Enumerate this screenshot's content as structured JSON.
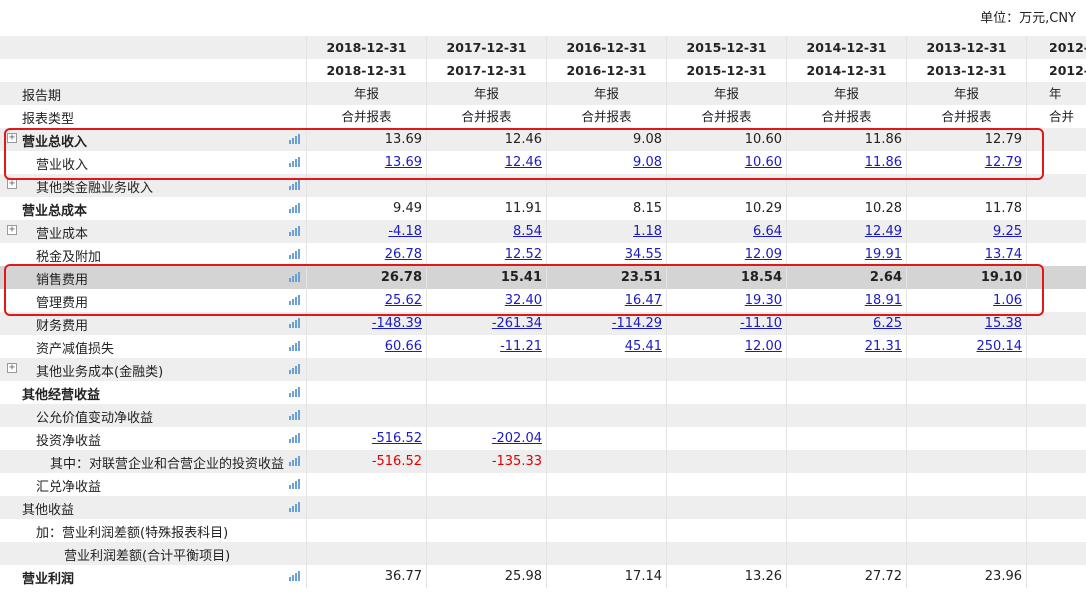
{
  "unit_label": "单位：万元,CNY",
  "header": {
    "dates_top": [
      "2018-12-31",
      "2017-12-31",
      "2016-12-31",
      "2015-12-31",
      "2014-12-31",
      "2013-12-31",
      "2012-"
    ],
    "dates_bottom": [
      "2018-12-31",
      "2017-12-31",
      "2016-12-31",
      "2015-12-31",
      "2014-12-31",
      "2013-12-31",
      "2012-"
    ],
    "period_label": "报告期",
    "periods": [
      "年报",
      "年报",
      "年报",
      "年报",
      "年报",
      "年报",
      "年"
    ],
    "type_label": "报表类型",
    "types": [
      "合并报表",
      "合并报表",
      "合并报表",
      "合并报表",
      "合并报表",
      "合并报表",
      "合并"
    ]
  },
  "rows": [
    {
      "label": "营业总收入",
      "bold": true,
      "expand": true,
      "chart": true,
      "values": [
        "13.69",
        "12.46",
        "9.08",
        "10.60",
        "11.86",
        "12.79",
        ""
      ]
    },
    {
      "label": "营业收入",
      "bold": false,
      "chart": true,
      "link": true,
      "values": [
        "13.69",
        "12.46",
        "9.08",
        "10.60",
        "11.86",
        "12.79",
        ""
      ]
    },
    {
      "label": "其他类金融业务收入",
      "bold": false,
      "expand": true,
      "chart": true,
      "values": [
        "",
        "",
        "",
        "",
        "",
        "",
        ""
      ]
    },
    {
      "label": "营业总成本",
      "bold": true,
      "chart": true,
      "values": [
        "9.49",
        "11.91",
        "8.15",
        "10.29",
        "10.28",
        "11.78",
        ""
      ]
    },
    {
      "label": "营业成本",
      "bold": false,
      "expand": true,
      "chart": true,
      "link": true,
      "values": [
        "-4.18",
        "8.54",
        "1.18",
        "6.64",
        "12.49",
        "9.25",
        ""
      ]
    },
    {
      "label": "税金及附加",
      "bold": false,
      "chart": true,
      "link": true,
      "values": [
        "26.78",
        "12.52",
        "34.55",
        "12.09",
        "19.91",
        "13.74",
        ""
      ]
    },
    {
      "label": "销售费用",
      "bold": false,
      "chart": true,
      "boldvals": true,
      "values": [
        "26.78",
        "15.41",
        "23.51",
        "18.54",
        "2.64",
        "19.10",
        ""
      ]
    },
    {
      "label": "管理费用",
      "bold": false,
      "chart": true,
      "link": true,
      "values": [
        "25.62",
        "32.40",
        "16.47",
        "19.30",
        "18.91",
        "1.06",
        ""
      ]
    },
    {
      "label": "财务费用",
      "bold": false,
      "chart": true,
      "link": true,
      "values": [
        "-148.39",
        "-261.34",
        "-114.29",
        "-11.10",
        "6.25",
        "15.38",
        ""
      ]
    },
    {
      "label": "资产减值损失",
      "bold": false,
      "chart": true,
      "link": true,
      "values": [
        "60.66",
        "-11.21",
        "45.41",
        "12.00",
        "21.31",
        "250.14",
        ""
      ]
    },
    {
      "label": "其他业务成本(金融类)",
      "bold": false,
      "expand": true,
      "chart": true,
      "values": [
        "",
        "",
        "",
        "",
        "",
        "",
        ""
      ]
    },
    {
      "label": "其他经营收益",
      "bold": true,
      "chart": true,
      "values": [
        "",
        "",
        "",
        "",
        "",
        "",
        ""
      ]
    },
    {
      "label": "公允价值变动净收益",
      "bold": false,
      "chart": true,
      "values": [
        "",
        "",
        "",
        "",
        "",
        "",
        ""
      ]
    },
    {
      "label": "投资净收益",
      "bold": false,
      "chart": true,
      "link": true,
      "values": [
        "-516.52",
        "-202.04",
        "",
        "",
        "",
        "",
        ""
      ]
    },
    {
      "label": "其中：对联营企业和合营企业的投资收益",
      "bold": false,
      "chart": true,
      "neg": true,
      "values": [
        "-516.52",
        "-135.33",
        "",
        "",
        "",
        "",
        ""
      ]
    },
    {
      "label": "汇兑净收益",
      "bold": false,
      "chart": true,
      "values": [
        "",
        "",
        "",
        "",
        "",
        "",
        ""
      ]
    },
    {
      "label": "其他收益",
      "bold": false,
      "chart": true,
      "values": [
        "",
        "",
        "",
        "",
        "",
        "",
        ""
      ]
    },
    {
      "label": "加：营业利润差额(特殊报表科目)",
      "bold": false,
      "chart": false,
      "values": [
        "",
        "",
        "",
        "",
        "",
        "",
        ""
      ]
    },
    {
      "label": "营业利润差额(合计平衡项目)",
      "bold": false,
      "chart": false,
      "values": [
        "",
        "",
        "",
        "",
        "",
        "",
        ""
      ]
    },
    {
      "label": "营业利润",
      "bold": true,
      "chart": true,
      "values": [
        "36.77",
        "25.98",
        "17.14",
        "13.26",
        "27.72",
        "23.96",
        ""
      ]
    }
  ]
}
